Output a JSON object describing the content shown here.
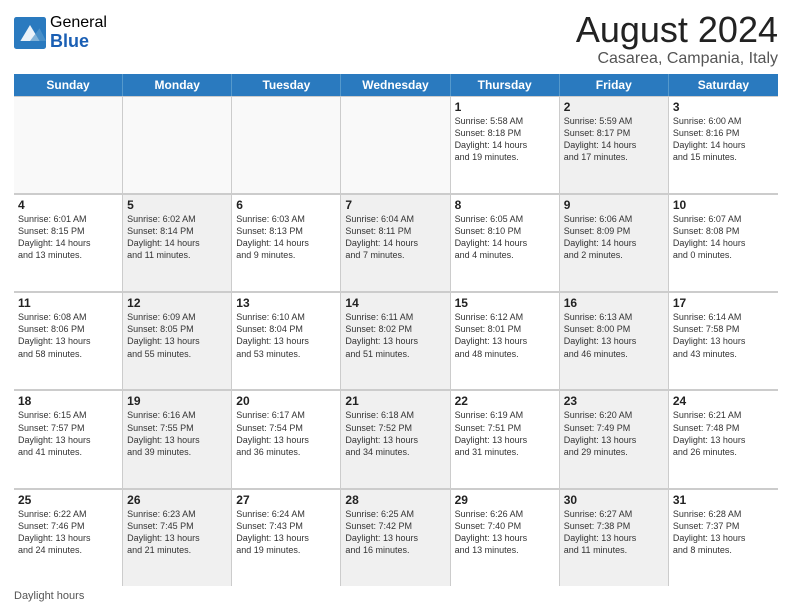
{
  "logo": {
    "general": "General",
    "blue": "Blue"
  },
  "title": "August 2024",
  "subtitle": "Casarea, Campania, Italy",
  "weekdays": [
    "Sunday",
    "Monday",
    "Tuesday",
    "Wednesday",
    "Thursday",
    "Friday",
    "Saturday"
  ],
  "weeks": [
    [
      {
        "day": "",
        "info": "",
        "shaded": false,
        "empty": true
      },
      {
        "day": "",
        "info": "",
        "shaded": false,
        "empty": true
      },
      {
        "day": "",
        "info": "",
        "shaded": false,
        "empty": true
      },
      {
        "day": "",
        "info": "",
        "shaded": false,
        "empty": true
      },
      {
        "day": "1",
        "info": "Sunrise: 5:58 AM\nSunset: 8:18 PM\nDaylight: 14 hours\nand 19 minutes.",
        "shaded": false
      },
      {
        "day": "2",
        "info": "Sunrise: 5:59 AM\nSunset: 8:17 PM\nDaylight: 14 hours\nand 17 minutes.",
        "shaded": true
      },
      {
        "day": "3",
        "info": "Sunrise: 6:00 AM\nSunset: 8:16 PM\nDaylight: 14 hours\nand 15 minutes.",
        "shaded": false
      }
    ],
    [
      {
        "day": "4",
        "info": "Sunrise: 6:01 AM\nSunset: 8:15 PM\nDaylight: 14 hours\nand 13 minutes.",
        "shaded": false
      },
      {
        "day": "5",
        "info": "Sunrise: 6:02 AM\nSunset: 8:14 PM\nDaylight: 14 hours\nand 11 minutes.",
        "shaded": true
      },
      {
        "day": "6",
        "info": "Sunrise: 6:03 AM\nSunset: 8:13 PM\nDaylight: 14 hours\nand 9 minutes.",
        "shaded": false
      },
      {
        "day": "7",
        "info": "Sunrise: 6:04 AM\nSunset: 8:11 PM\nDaylight: 14 hours\nand 7 minutes.",
        "shaded": true
      },
      {
        "day": "8",
        "info": "Sunrise: 6:05 AM\nSunset: 8:10 PM\nDaylight: 14 hours\nand 4 minutes.",
        "shaded": false
      },
      {
        "day": "9",
        "info": "Sunrise: 6:06 AM\nSunset: 8:09 PM\nDaylight: 14 hours\nand 2 minutes.",
        "shaded": true
      },
      {
        "day": "10",
        "info": "Sunrise: 6:07 AM\nSunset: 8:08 PM\nDaylight: 14 hours\nand 0 minutes.",
        "shaded": false
      }
    ],
    [
      {
        "day": "11",
        "info": "Sunrise: 6:08 AM\nSunset: 8:06 PM\nDaylight: 13 hours\nand 58 minutes.",
        "shaded": false
      },
      {
        "day": "12",
        "info": "Sunrise: 6:09 AM\nSunset: 8:05 PM\nDaylight: 13 hours\nand 55 minutes.",
        "shaded": true
      },
      {
        "day": "13",
        "info": "Sunrise: 6:10 AM\nSunset: 8:04 PM\nDaylight: 13 hours\nand 53 minutes.",
        "shaded": false
      },
      {
        "day": "14",
        "info": "Sunrise: 6:11 AM\nSunset: 8:02 PM\nDaylight: 13 hours\nand 51 minutes.",
        "shaded": true
      },
      {
        "day": "15",
        "info": "Sunrise: 6:12 AM\nSunset: 8:01 PM\nDaylight: 13 hours\nand 48 minutes.",
        "shaded": false
      },
      {
        "day": "16",
        "info": "Sunrise: 6:13 AM\nSunset: 8:00 PM\nDaylight: 13 hours\nand 46 minutes.",
        "shaded": true
      },
      {
        "day": "17",
        "info": "Sunrise: 6:14 AM\nSunset: 7:58 PM\nDaylight: 13 hours\nand 43 minutes.",
        "shaded": false
      }
    ],
    [
      {
        "day": "18",
        "info": "Sunrise: 6:15 AM\nSunset: 7:57 PM\nDaylight: 13 hours\nand 41 minutes.",
        "shaded": false
      },
      {
        "day": "19",
        "info": "Sunrise: 6:16 AM\nSunset: 7:55 PM\nDaylight: 13 hours\nand 39 minutes.",
        "shaded": true
      },
      {
        "day": "20",
        "info": "Sunrise: 6:17 AM\nSunset: 7:54 PM\nDaylight: 13 hours\nand 36 minutes.",
        "shaded": false
      },
      {
        "day": "21",
        "info": "Sunrise: 6:18 AM\nSunset: 7:52 PM\nDaylight: 13 hours\nand 34 minutes.",
        "shaded": true
      },
      {
        "day": "22",
        "info": "Sunrise: 6:19 AM\nSunset: 7:51 PM\nDaylight: 13 hours\nand 31 minutes.",
        "shaded": false
      },
      {
        "day": "23",
        "info": "Sunrise: 6:20 AM\nSunset: 7:49 PM\nDaylight: 13 hours\nand 29 minutes.",
        "shaded": true
      },
      {
        "day": "24",
        "info": "Sunrise: 6:21 AM\nSunset: 7:48 PM\nDaylight: 13 hours\nand 26 minutes.",
        "shaded": false
      }
    ],
    [
      {
        "day": "25",
        "info": "Sunrise: 6:22 AM\nSunset: 7:46 PM\nDaylight: 13 hours\nand 24 minutes.",
        "shaded": false
      },
      {
        "day": "26",
        "info": "Sunrise: 6:23 AM\nSunset: 7:45 PM\nDaylight: 13 hours\nand 21 minutes.",
        "shaded": true
      },
      {
        "day": "27",
        "info": "Sunrise: 6:24 AM\nSunset: 7:43 PM\nDaylight: 13 hours\nand 19 minutes.",
        "shaded": false
      },
      {
        "day": "28",
        "info": "Sunrise: 6:25 AM\nSunset: 7:42 PM\nDaylight: 13 hours\nand 16 minutes.",
        "shaded": true
      },
      {
        "day": "29",
        "info": "Sunrise: 6:26 AM\nSunset: 7:40 PM\nDaylight: 13 hours\nand 13 minutes.",
        "shaded": false
      },
      {
        "day": "30",
        "info": "Sunrise: 6:27 AM\nSunset: 7:38 PM\nDaylight: 13 hours\nand 11 minutes.",
        "shaded": true
      },
      {
        "day": "31",
        "info": "Sunrise: 6:28 AM\nSunset: 7:37 PM\nDaylight: 13 hours\nand 8 minutes.",
        "shaded": false
      }
    ]
  ],
  "footer": "Daylight hours"
}
